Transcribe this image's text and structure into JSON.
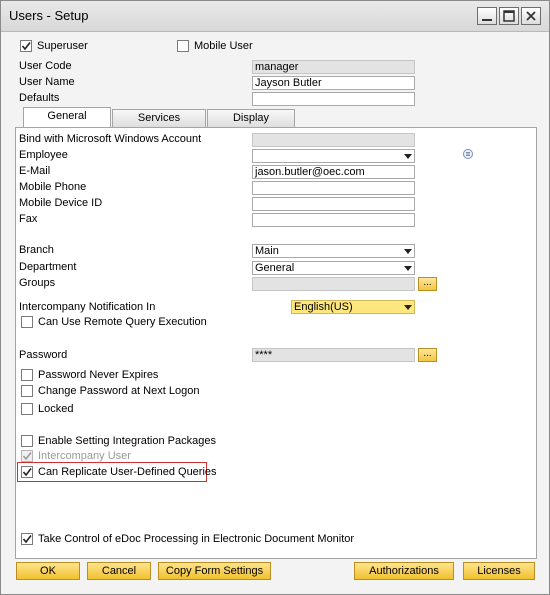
{
  "window": {
    "title": "Users - Setup"
  },
  "top": {
    "superuser_label": "Superuser",
    "superuser_checked": true,
    "mobile_user_label": "Mobile User",
    "mobile_user_checked": false,
    "user_code_label": "User Code",
    "user_code_value": "manager",
    "user_name_label": "User Name",
    "user_name_value": "Jayson Butler",
    "defaults_label": "Defaults",
    "defaults_value": ""
  },
  "tabs": [
    {
      "label": "General",
      "active": true
    },
    {
      "label": "Services",
      "active": false
    },
    {
      "label": "Display",
      "active": false
    }
  ],
  "general": {
    "bind_windows_label": "Bind with Microsoft Windows Account",
    "bind_windows_value": "",
    "employee_label": "Employee",
    "employee_value": "",
    "email_label": "E-Mail",
    "email_value": "jason.butler@oec.com",
    "mobile_phone_label": "Mobile Phone",
    "mobile_phone_value": "",
    "mobile_device_label": "Mobile Device ID",
    "mobile_device_value": "",
    "fax_label": "Fax",
    "fax_value": "",
    "branch_label": "Branch",
    "branch_value": "Main",
    "department_label": "Department",
    "department_value": "General",
    "groups_label": "Groups",
    "groups_value": "",
    "intercompany_notification_label": "Intercompany Notification In",
    "intercompany_notification_value": "English(US)",
    "remote_query_label": "Can Use Remote Query Execution",
    "remote_query_checked": false,
    "password_label": "Password",
    "password_value": "****",
    "password_never_expires_label": "Password Never Expires",
    "password_never_expires_checked": false,
    "change_password_label": "Change Password at Next Logon",
    "change_password_checked": false,
    "locked_label": "Locked",
    "locked_checked": false,
    "integration_packages_label": "Enable Setting Integration Packages",
    "integration_packages_checked": false,
    "intercompany_user_label": "Intercompany User",
    "intercompany_user_checked": true,
    "replicate_queries_label": "Can Replicate User-Defined Queries",
    "replicate_queries_checked": true,
    "edoc_label": "Take Control of eDoc Processing in Electronic Document Monitor",
    "edoc_checked": true,
    "ellipsis": "..."
  },
  "buttons": {
    "ok": "OK",
    "cancel": "Cancel",
    "copy_form_settings": "Copy Form Settings",
    "authorizations": "Authorizations",
    "licenses": "Licenses"
  },
  "colors": {
    "button_gold": "#f0c031",
    "highlight_red": "#d32f2f",
    "dropdown_yellow": "#fde77e"
  }
}
